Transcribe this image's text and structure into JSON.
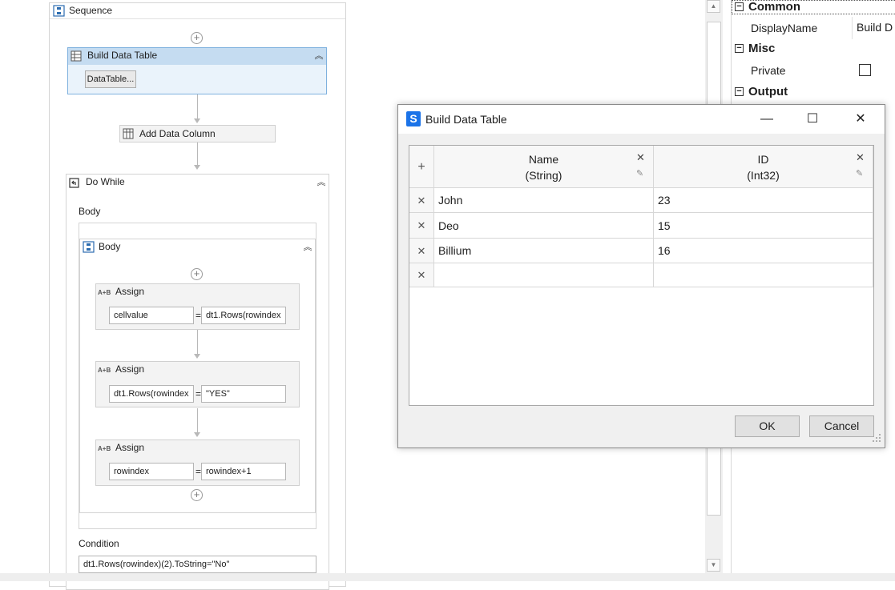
{
  "designer": {
    "sequence_title": "Sequence",
    "build_data_table": {
      "title": "Build Data Table",
      "button_label": "DataTable..."
    },
    "add_data_column": {
      "title": "Add Data Column"
    },
    "do_while": {
      "title": "Do While",
      "body_label": "Body",
      "inner_body_title": "Body",
      "condition_label": "Condition",
      "condition_value": "dt1.Rows(rowindex)(2).ToString=\"No\""
    },
    "assigns": [
      {
        "tag": "A+B",
        "title": "Assign",
        "to": "cellvalue",
        "eq": "=",
        "value": "dt1.Rows(rowindex"
      },
      {
        "tag": "A+B",
        "title": "Assign",
        "to": "dt1.Rows(rowindex",
        "eq": "=",
        "value": "\"YES\""
      },
      {
        "tag": "A+B",
        "title": "Assign",
        "to": "rowindex",
        "eq": "=",
        "value": "rowindex+1"
      }
    ]
  },
  "properties": {
    "categories": [
      {
        "label": "Common",
        "toggle": "−"
      },
      {
        "label": "Misc",
        "toggle": "−"
      },
      {
        "label": "Output",
        "toggle": "−"
      }
    ],
    "display_name_label": "DisplayName",
    "display_name_value": "Build D",
    "private_label": "Private"
  },
  "dialog": {
    "title": "Build Data Table",
    "minimize": "—",
    "maximize": "☐",
    "close": "✕",
    "add_column_glyph": "+",
    "columns": [
      {
        "name": "Name",
        "type": "(String)",
        "remove": "✕",
        "edit": "✎"
      },
      {
        "name": "ID",
        "type": "(Int32)",
        "remove": "✕",
        "edit": "✎"
      }
    ],
    "rows": [
      {
        "remove": "✕",
        "cells": [
          "John",
          "23"
        ]
      },
      {
        "remove": "✕",
        "cells": [
          "Deo",
          "15"
        ]
      },
      {
        "remove": "✕",
        "cells": [
          "Billium",
          "16"
        ]
      },
      {
        "remove": "✕",
        "cells": [
          "",
          ""
        ]
      }
    ],
    "ok_label": "OK",
    "cancel_label": "Cancel"
  },
  "icons": {
    "plus": "+",
    "collapse": "︽",
    "scroll_up": "▲",
    "scroll_down": "▼"
  }
}
